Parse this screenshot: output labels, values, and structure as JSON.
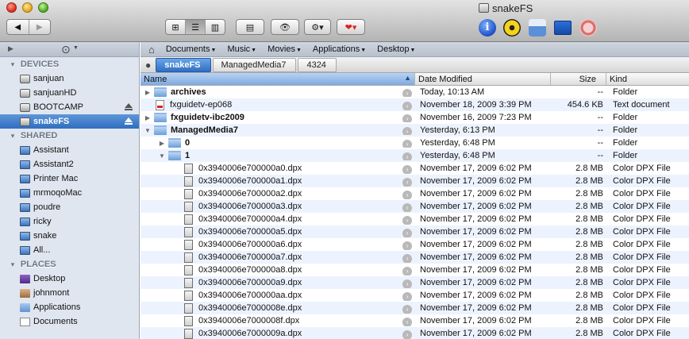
{
  "window": {
    "title": "snakeFS"
  },
  "toolbar": {
    "back_label": "◀",
    "forward_label": "▶",
    "view_icons_label": "⊞",
    "view_list_label": "☰",
    "view_columns_label": "▥",
    "coverflow_label": "▤",
    "quicklook_label": "👁",
    "action_label": "⚙▾",
    "label_label": "❤▾"
  },
  "favorites": [
    {
      "label": "Documents"
    },
    {
      "label": "Music"
    },
    {
      "label": "Movies"
    },
    {
      "label": "Applications"
    },
    {
      "label": "Desktop"
    }
  ],
  "sidebar": {
    "devices_header": "DEVICES",
    "devices": [
      {
        "label": "sanjuan"
      },
      {
        "label": "sanjuanHD"
      },
      {
        "label": "BOOTCAMP"
      },
      {
        "label": "snakeFS"
      }
    ],
    "shared_header": "SHARED",
    "shared": [
      {
        "label": "Assistant"
      },
      {
        "label": "Assistant2"
      },
      {
        "label": "Printer Mac"
      },
      {
        "label": "mrmoqoMac"
      },
      {
        "label": "poudre"
      },
      {
        "label": "ricky"
      },
      {
        "label": "snake"
      },
      {
        "label": "All..."
      }
    ],
    "places_header": "PLACES",
    "places": [
      {
        "label": "Desktop"
      },
      {
        "label": "johnmont"
      },
      {
        "label": "Applications"
      },
      {
        "label": "Documents"
      }
    ]
  },
  "path": {
    "crumbs": [
      {
        "label": "snakeFS"
      },
      {
        "label": "ManagedMedia7"
      },
      {
        "label": "4324"
      }
    ]
  },
  "columns": {
    "name": "Name",
    "date": "Date Modified",
    "size": "Size",
    "kind": "Kind"
  },
  "rows": [
    {
      "name": "archives",
      "date": "Today, 10:13 AM",
      "size": "--",
      "kind": "Folder"
    },
    {
      "name": "fxguidetv-ep068",
      "date": "November 18, 2009 3:39 PM",
      "size": "454.6 KB",
      "kind": "Text document"
    },
    {
      "name": "fxguidetv-ibc2009",
      "date": "November 16, 2009 7:23 PM",
      "size": "--",
      "kind": "Folder"
    },
    {
      "name": "ManagedMedia7",
      "date": "Yesterday, 6:13 PM",
      "size": "--",
      "kind": "Folder"
    },
    {
      "name": "0",
      "date": "Yesterday, 6:48 PM",
      "size": "--",
      "kind": "Folder"
    },
    {
      "name": "1",
      "date": "Yesterday, 6:48 PM",
      "size": "--",
      "kind": "Folder"
    },
    {
      "name": "0x3940006e700000a0.dpx",
      "date": "November 17, 2009 6:02 PM",
      "size": "2.8 MB",
      "kind": "Color DPX File"
    },
    {
      "name": "0x3940006e700000a1.dpx",
      "date": "November 17, 2009 6:02 PM",
      "size": "2.8 MB",
      "kind": "Color DPX File"
    },
    {
      "name": "0x3940006e700000a2.dpx",
      "date": "November 17, 2009 6:02 PM",
      "size": "2.8 MB",
      "kind": "Color DPX File"
    },
    {
      "name": "0x3940006e700000a3.dpx",
      "date": "November 17, 2009 6:02 PM",
      "size": "2.8 MB",
      "kind": "Color DPX File"
    },
    {
      "name": "0x3940006e700000a4.dpx",
      "date": "November 17, 2009 6:02 PM",
      "size": "2.8 MB",
      "kind": "Color DPX File"
    },
    {
      "name": "0x3940006e700000a5.dpx",
      "date": "November 17, 2009 6:02 PM",
      "size": "2.8 MB",
      "kind": "Color DPX File"
    },
    {
      "name": "0x3940006e700000a6.dpx",
      "date": "November 17, 2009 6:02 PM",
      "size": "2.8 MB",
      "kind": "Color DPX File"
    },
    {
      "name": "0x3940006e700000a7.dpx",
      "date": "November 17, 2009 6:02 PM",
      "size": "2.8 MB",
      "kind": "Color DPX File"
    },
    {
      "name": "0x3940006e700000a8.dpx",
      "date": "November 17, 2009 6:02 PM",
      "size": "2.8 MB",
      "kind": "Color DPX File"
    },
    {
      "name": "0x3940006e700000a9.dpx",
      "date": "November 17, 2009 6:02 PM",
      "size": "2.8 MB",
      "kind": "Color DPX File"
    },
    {
      "name": "0x3940006e700000aa.dpx",
      "date": "November 17, 2009 6:02 PM",
      "size": "2.8 MB",
      "kind": "Color DPX File"
    },
    {
      "name": "0x3940006e7000008e.dpx",
      "date": "November 17, 2009 6:02 PM",
      "size": "2.8 MB",
      "kind": "Color DPX File"
    },
    {
      "name": "0x3940006e7000008f.dpx",
      "date": "November 17, 2009 6:02 PM",
      "size": "2.8 MB",
      "kind": "Color DPX File"
    },
    {
      "name": "0x3940006e7000009a.dpx",
      "date": "November 17, 2009 6:02 PM",
      "size": "2.8 MB",
      "kind": "Color DPX File"
    }
  ]
}
